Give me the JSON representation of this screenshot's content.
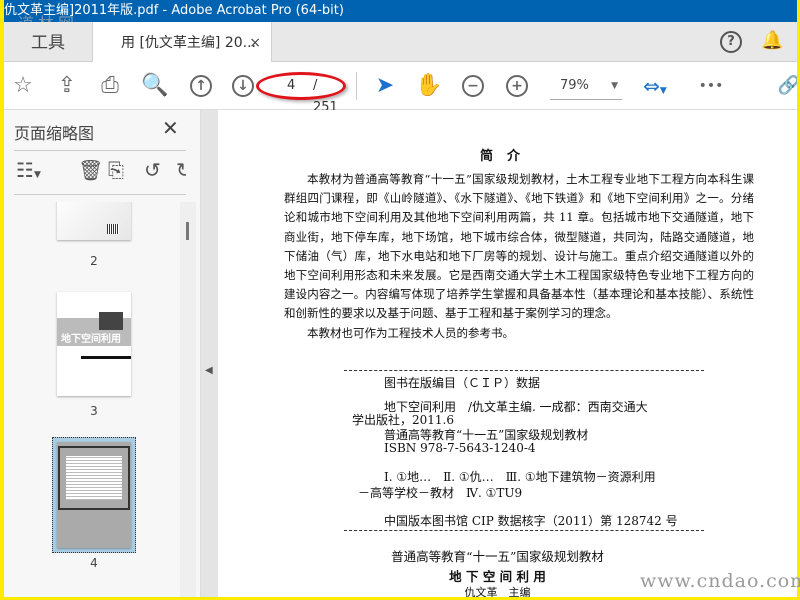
{
  "window": {
    "title": "仇文革主编]2011年版.pdf - Adobe Acrobat Pro (64-bit)"
  },
  "watermarks": {
    "top_left": "道林网",
    "bottom_right": "www.cndao.com"
  },
  "tabs": {
    "tools": "工具",
    "document": "用 [仇文革主编] 20...",
    "close": "×"
  },
  "header": {
    "help": "?",
    "bell": "🔔"
  },
  "toolbar": {
    "current_page": "4",
    "total_pages": "/ 251",
    "zoom": "79%",
    "more": "•••"
  },
  "panel": {
    "title": "页面缩略图",
    "close": "✕",
    "thumbnails": [
      {
        "label": "2"
      },
      {
        "label": "3",
        "cover_text": "地下空间利用"
      },
      {
        "label": "4",
        "selected": true
      }
    ]
  },
  "document": {
    "heading": "简介",
    "paragraphs": [
      "本教材为普通高等教育“十一五”国家级规划教材，土木工程专业地下工程方向本科生课群组四门课程，即《山岭隧道》、《水下隧道》、《地下铁道》和《地下空间利用》之一。分绪论和城市地下空间利用及其他地下空间利用两篇，共 11 章。包括城市地下交通隧道，地下商业街，地下停车库，地下场馆，地下城市综合体，微型隧道，共同沟，陆路交通隧道，地下储油（气）库，地下水电站和地下厂房等的规划、设计与施工。重点介绍交通隧道以外的地下空间利用形态和未来发展。它是西南交通大学土木工程国家级特色专业地下工程方向的建设内容之一。内容编写体现了培养学生掌握和具备基本性（基本理论和基本技能）、系统性和创新性的要求以及基于问题、基于工程和基于案例学习的理念。",
      "本教材也可作为工程技术人员的参考书。"
    ],
    "cip": {
      "heading": "图书在版编目（ＣＩＰ）数据",
      "line1": "地下空间利用　/仇文革主编. 一成都：西南交通大",
      "line2": "学出版社，2011.6",
      "line3": "普通高等教育“十一五”国家级规划教材",
      "line4": "ISBN 978-7-5643-1240-4",
      "line5": "Ⅰ. ①地…　Ⅱ. ①仇…　Ⅲ. ①地下建筑物－资源利用",
      "line6": "－高等学校－教材　Ⅳ. ①TU9",
      "line7": "中国版本图书馆 CIP 数据核字（2011）第 128742 号"
    },
    "series": "普通高等教育“十一五”国家级规划教材",
    "book_title": "地 下 空 间 利 用",
    "author": "仇文革　主编"
  }
}
